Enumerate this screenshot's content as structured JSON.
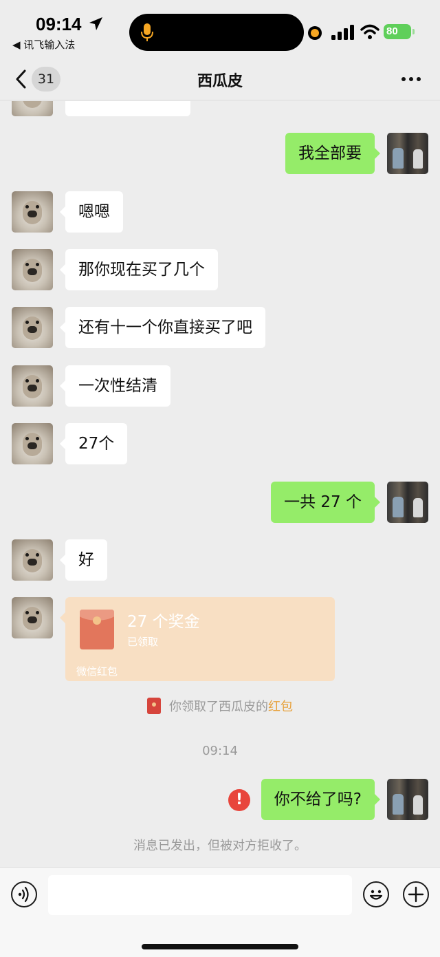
{
  "status_bar": {
    "time": "09:14",
    "back_app": "◀ 讯飞输入法",
    "battery": "80",
    "icons": [
      "location-arrow-icon",
      "mic-icon",
      "signal-icon",
      "wifi-icon",
      "battery-icon"
    ]
  },
  "header": {
    "unread_count": "31",
    "title": "西瓜皮",
    "icons": [
      "back-chevron-icon",
      "more-icon"
    ]
  },
  "messages": [
    {
      "from": "me",
      "text": "我全部要"
    },
    {
      "from": "other",
      "text": "嗯嗯"
    },
    {
      "from": "other",
      "text": "那你现在买了几个"
    },
    {
      "from": "other",
      "text": "还有十一个你直接买了吧"
    },
    {
      "from": "other",
      "text": "一次性结清"
    },
    {
      "from": "other",
      "text": "27个"
    },
    {
      "from": "me",
      "text": "一共 27 个"
    },
    {
      "from": "other",
      "text": "好"
    },
    {
      "from": "me",
      "text": "你不给了吗?"
    }
  ],
  "red_packet": {
    "title": "27 个奖金",
    "status": "已领取",
    "brand": "微信红包"
  },
  "system": {
    "received_prefix": "你领取了西瓜皮的",
    "received_link": "红包",
    "timestamp": "09:14",
    "rejected": "消息已发出，但被对方拒收了。"
  },
  "input_bar": {
    "placeholder": "",
    "icons": [
      "voice-icon",
      "emoji-icon",
      "plus-icon"
    ]
  },
  "colors": {
    "background": "#ededed",
    "outgoing_bubble": "#95ec69",
    "incoming_bubble": "#ffffff",
    "red_packet": "#f8dfc3",
    "error": "#e8453c",
    "link": "#e7a13c"
  }
}
